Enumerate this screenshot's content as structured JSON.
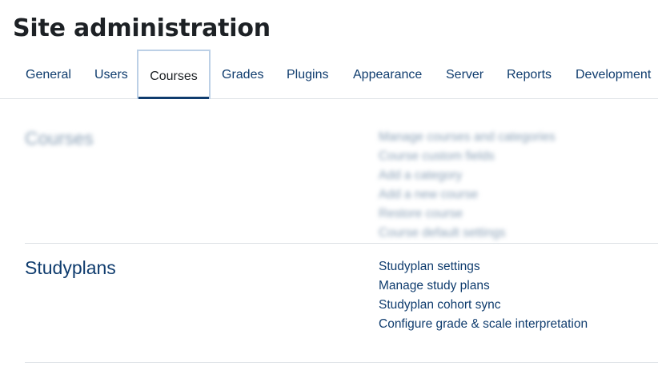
{
  "page": {
    "title": "Site administration"
  },
  "tabs": [
    {
      "label": "General",
      "active": false
    },
    {
      "label": "Users",
      "active": false
    },
    {
      "label": "Courses",
      "active": true
    },
    {
      "label": "Grades",
      "active": false
    },
    {
      "label": "Plugins",
      "active": false
    },
    {
      "label": "Appearance",
      "active": false
    },
    {
      "label": "Server",
      "active": false
    },
    {
      "label": "Reports",
      "active": false
    },
    {
      "label": "Development",
      "active": false
    }
  ],
  "sections": [
    {
      "heading": "Courses",
      "blurred": true,
      "links": [
        "Manage courses and categories",
        "Course custom fields",
        "Add a category",
        "Add a new course",
        "Restore course",
        "Course default settings"
      ]
    },
    {
      "heading": "Studyplans",
      "blurred": false,
      "links": [
        "Studyplan settings",
        "Manage study plans",
        "Studyplan cohort sync",
        "Configure grade & scale interpretation"
      ]
    }
  ],
  "colors": {
    "link": "#0f3c6e",
    "active_tab_underline": "#0f3c6e",
    "active_tab_border": "#bcd0e6",
    "divider": "#dee2e6",
    "title": "#1d2125"
  }
}
